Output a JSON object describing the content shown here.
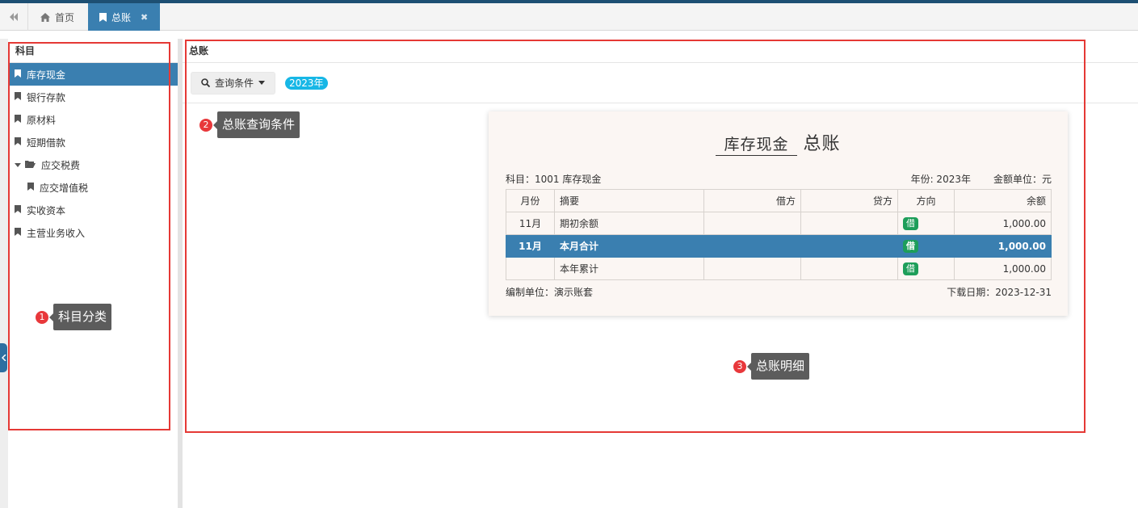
{
  "tabs": [
    {
      "label": "首页",
      "icon": "home-icon"
    },
    {
      "label": "总账",
      "icon": "bookmark-icon",
      "close": "✖"
    }
  ],
  "sidebar": {
    "title": "科目",
    "items": [
      {
        "label": "库存现金",
        "active": true
      },
      {
        "label": "银行存款"
      },
      {
        "label": "原材料"
      },
      {
        "label": "短期借款"
      },
      {
        "label": "应交税费",
        "folder": true,
        "expanded": true
      },
      {
        "label": "应交增值税",
        "child": true
      },
      {
        "label": "实收资本"
      },
      {
        "label": "主营业务收入"
      }
    ]
  },
  "main": {
    "title": "总账",
    "toolbar": {
      "query_label": "查询条件",
      "year_badge": "2023年"
    }
  },
  "report": {
    "subject_name": "库存现金",
    "title_suffix": "总账",
    "subject_line": "科目：1001  库存现金",
    "year_line": "年份: 2023年",
    "unit_line": "金额单位：元",
    "columns": [
      "月份",
      "摘要",
      "借方",
      "贷方",
      "方向",
      "余额"
    ],
    "rows": [
      {
        "month": "11月",
        "summary": "期初余额",
        "debit": "",
        "credit": "",
        "direction": "借",
        "balance": "1,000.00"
      },
      {
        "month": "11月",
        "summary": "本月合计",
        "debit": "",
        "credit": "",
        "direction": "借",
        "balance": "1,000.00"
      },
      {
        "month": "",
        "summary": "本年累计",
        "debit": "",
        "credit": "",
        "direction": "借",
        "balance": "1,000.00"
      }
    ],
    "footer_org": "编制单位：演示账套",
    "footer_date": "下载日期：2023-12-31"
  },
  "annotations": [
    {
      "num": "1",
      "label": "科目分类"
    },
    {
      "num": "2",
      "label": "总账查询条件"
    },
    {
      "num": "3",
      "label": "总账明细"
    }
  ],
  "colors": {
    "accent": "#3a7fb0",
    "highlight_box": "#e53935",
    "badge": "#17b7e6",
    "direction_badge": "#1e9e5a"
  }
}
